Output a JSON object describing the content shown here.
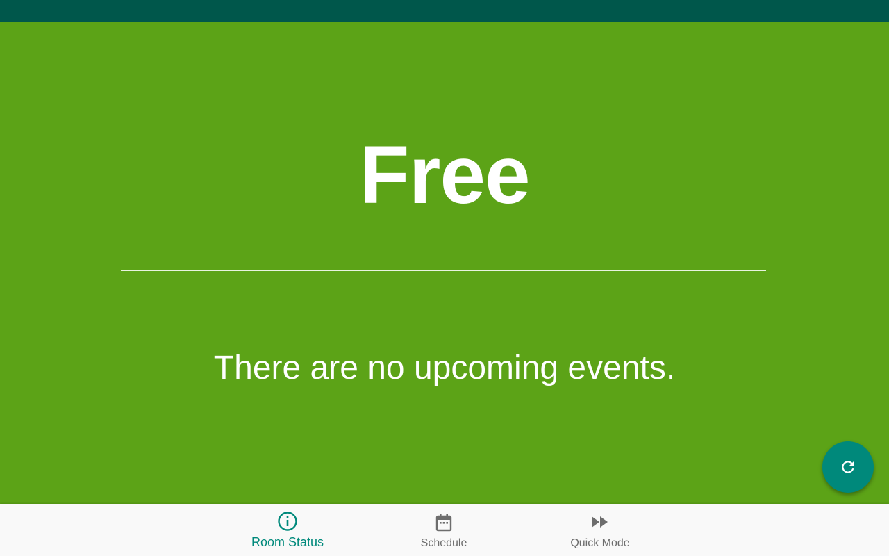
{
  "status": {
    "title": "Free",
    "message": "There are no upcoming events."
  },
  "fab": {
    "icon": "refresh-icon"
  },
  "bottom_nav": {
    "items": [
      {
        "label": "Room Status",
        "icon": "info-icon",
        "active": true
      },
      {
        "label": "Schedule",
        "icon": "calendar-icon",
        "active": false
      },
      {
        "label": "Quick Mode",
        "icon": "fast-forward-icon",
        "active": false
      }
    ]
  },
  "colors": {
    "status_bar": "#00574b",
    "background_free": "#5ca317",
    "accent": "#00897b",
    "nav_background": "#f9f9f9",
    "nav_inactive": "#6d6d6d"
  }
}
